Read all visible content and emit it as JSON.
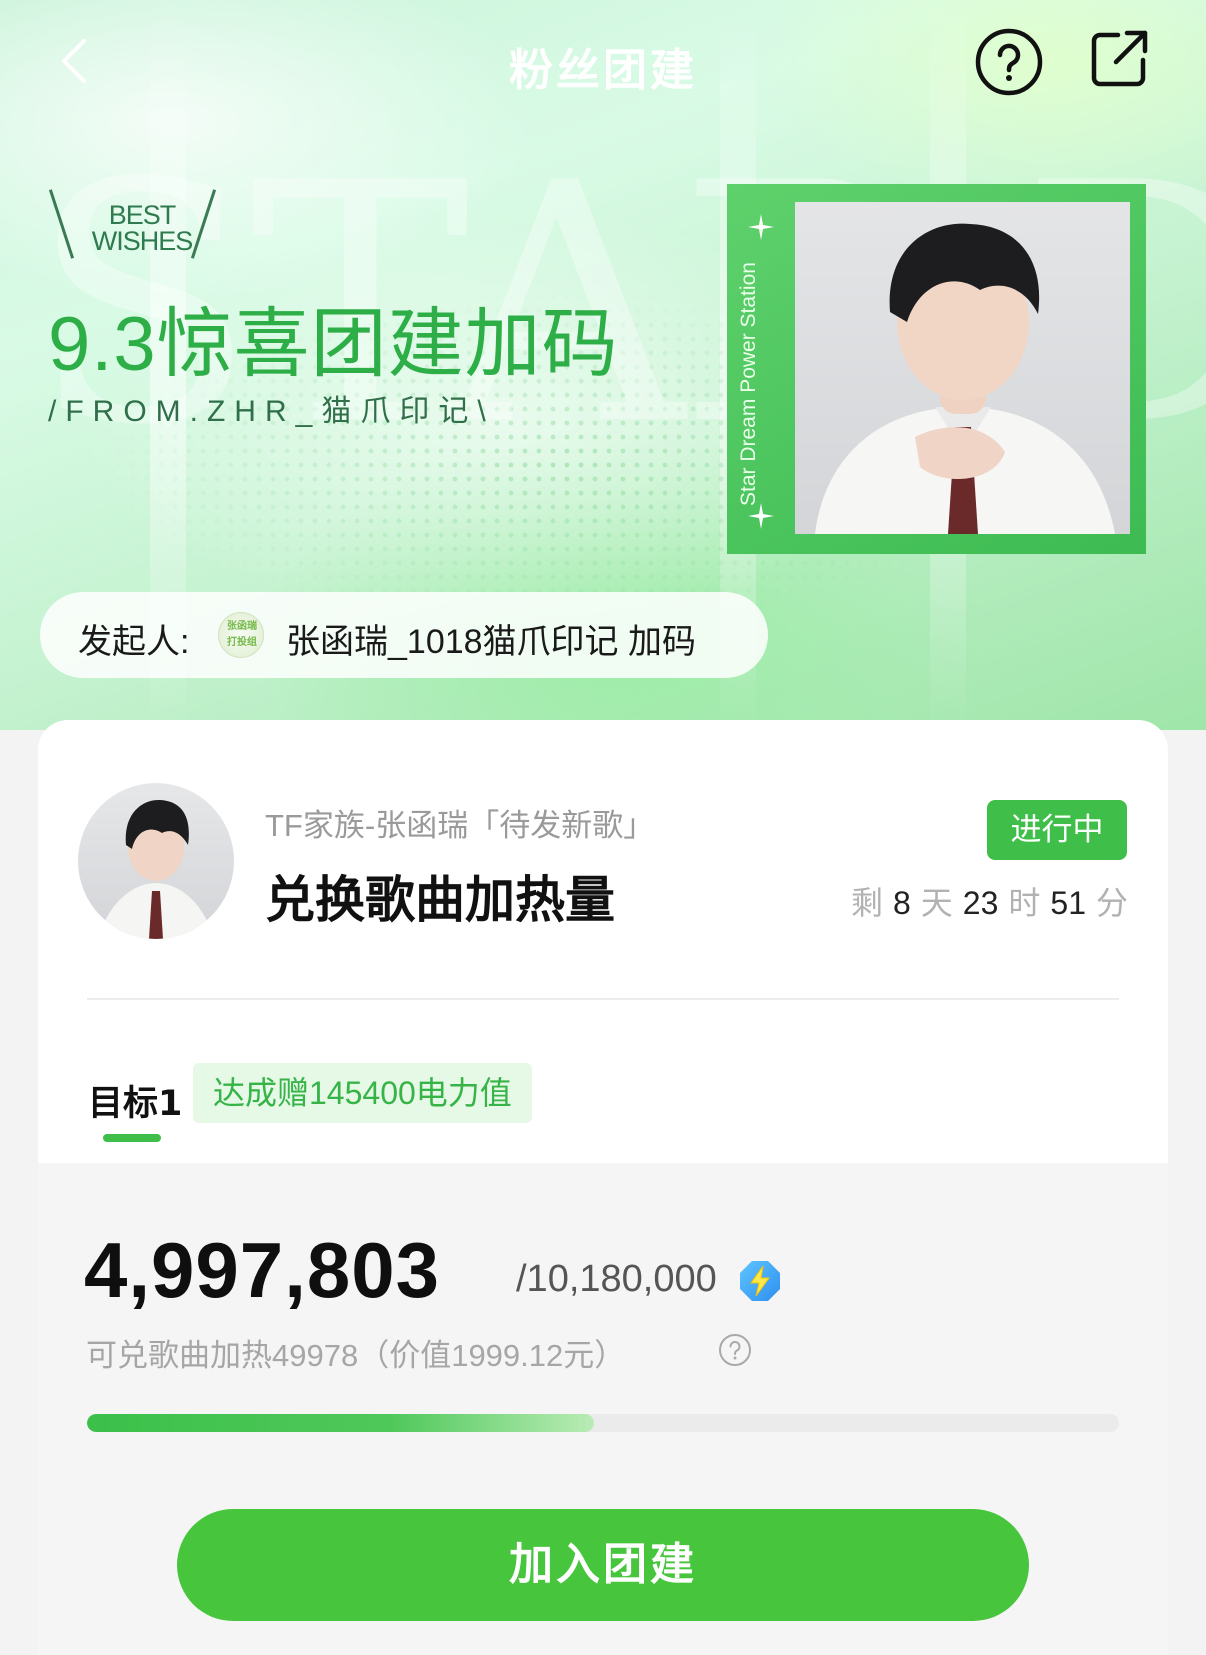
{
  "header": {
    "title": "粉丝团建",
    "back_icon": "chevron-left-icon",
    "help_icon": "question-circle-icon",
    "share_icon": "share-external-icon"
  },
  "banner": {
    "background_text": "STAR DREAM",
    "best_wishes_line1": "BEST",
    "best_wishes_line2": "WISHES",
    "title": "9.3惊喜团建加码",
    "from": "/FROM.ZHR_猫爪印记\\",
    "station_label": "Star Dream Power Station",
    "frame_color": "#3dbb52",
    "title_color": "#2dae47"
  },
  "initiator": {
    "label": "发起人:",
    "avatar_text": "张函瑞打投组",
    "name": "张函瑞_1018猫爪印记 加码"
  },
  "event": {
    "subtitle": "TF家族-张函瑞「待发新歌」",
    "title": "兑换歌曲加热量",
    "status": "进行中",
    "countdown": {
      "prefix": "剩",
      "days": "8",
      "days_unit": "天",
      "hours": "23",
      "hours_unit": "时",
      "minutes": "51",
      "minutes_unit": "分"
    }
  },
  "goal": {
    "tab_label": "目标1",
    "reward": "达成赠145400电力值",
    "current": "4,997,803",
    "target": "/10,180,000",
    "unit_icon": "lightning-bolt-icon",
    "redeem_text": "可兑歌曲加热49978（价值1999.12元）",
    "progress_fraction": 0.491,
    "accent_color": "#3fbf49"
  },
  "actions": {
    "join_label": "加入团建"
  }
}
